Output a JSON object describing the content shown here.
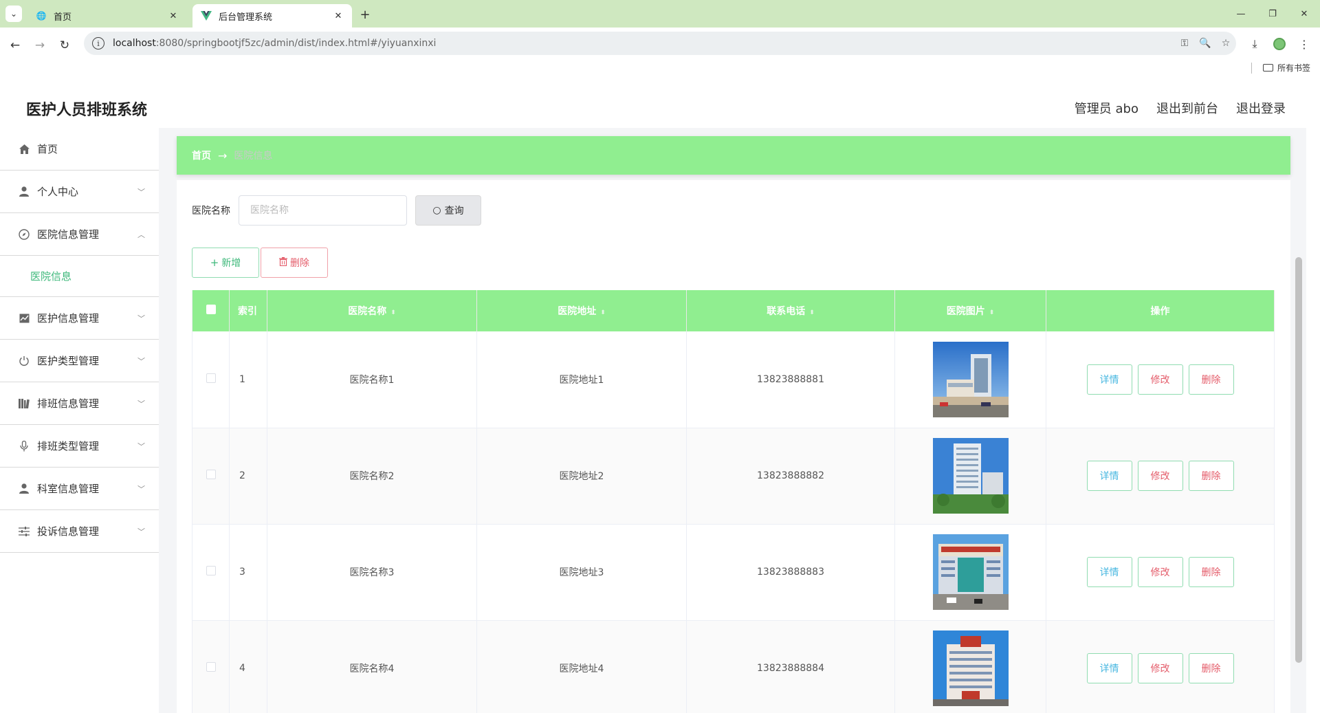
{
  "browser": {
    "tabs": [
      {
        "title": "首页",
        "icon": "globe-icon"
      },
      {
        "title": "后台管理系统",
        "icon": "vue-logo-icon"
      }
    ],
    "url_host": "localhost",
    "url_rest": ":8080/springbootjf5zc/admin/dist/index.html#/yiyuanxinxi",
    "bookmarks_label": "所有书签"
  },
  "header": {
    "title": "医护人员排班系统",
    "user": "管理员 abo",
    "to_front": "退出到前台",
    "logout": "退出登录"
  },
  "sidebar": {
    "items": [
      {
        "label": "首页",
        "icon": "home-icon"
      },
      {
        "label": "个人中心",
        "icon": "user-icon"
      },
      {
        "label": "医院信息管理",
        "icon": "compass-icon"
      },
      {
        "label": "医院信息",
        "icon": ""
      },
      {
        "label": "医护信息管理",
        "icon": "chart-icon"
      },
      {
        "label": "医护类型管理",
        "icon": "power-icon"
      },
      {
        "label": "排班信息管理",
        "icon": "books-icon"
      },
      {
        "label": "排班类型管理",
        "icon": "mic-icon"
      },
      {
        "label": "科室信息管理",
        "icon": "user-icon"
      },
      {
        "label": "投诉信息管理",
        "icon": "sliders-icon"
      }
    ]
  },
  "breadcrumb": {
    "home": "首页",
    "current": "医院信息"
  },
  "search": {
    "label": "医院名称",
    "placeholder": "医院名称",
    "button": "查询"
  },
  "actions": {
    "add": "新增",
    "delete": "删除"
  },
  "table": {
    "headers": [
      "索引",
      "医院名称",
      "医院地址",
      "联系电话",
      "医院图片",
      "操作"
    ],
    "rows": [
      {
        "index": "1",
        "name": "医院名称1",
        "address": "医院地址1",
        "phone": "13823888881"
      },
      {
        "index": "2",
        "name": "医院名称2",
        "address": "医院地址2",
        "phone": "13823888882"
      },
      {
        "index": "3",
        "name": "医院名称3",
        "address": "医院地址3",
        "phone": "13823888883"
      },
      {
        "index": "4",
        "name": "医院名称4",
        "address": "医院地址4",
        "phone": "13823888884"
      }
    ],
    "row_actions": {
      "detail": "详情",
      "edit": "修改",
      "remove": "删除"
    }
  },
  "colors": {
    "accent": "#90ee90",
    "primary_text": "#3db87a",
    "danger": "#e45c6a"
  }
}
